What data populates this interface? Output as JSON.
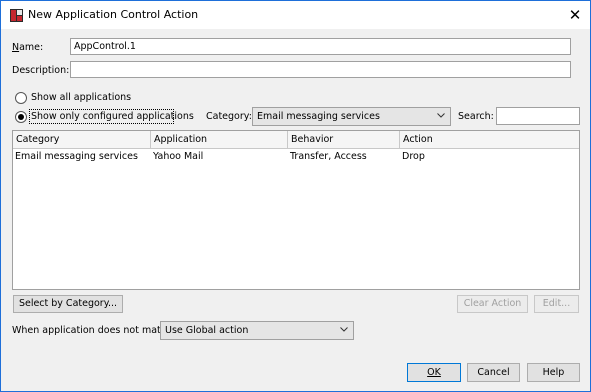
{
  "window": {
    "title": "New Application Control Action",
    "close_glyph": "✕",
    "icon": "app-icon"
  },
  "form": {
    "name_label": "Name:",
    "name_value": "AppControl.1",
    "description_label": "Description:",
    "description_value": ""
  },
  "filter": {
    "radio_all_label": "Show all applications",
    "radio_configured_label": "Show only configured applications",
    "selected": "configured",
    "category_label": "Category:",
    "category_value": "Email messaging services",
    "search_label": "Search:",
    "search_value": ""
  },
  "table": {
    "columns": [
      "Category",
      "Application",
      "Behavior",
      "Action"
    ],
    "rows": [
      [
        "Email messaging services",
        "Yahoo Mail",
        "Transfer, Access",
        "Drop"
      ]
    ]
  },
  "actions": {
    "select_by_category": "Select by Category...",
    "clear_action": "Clear Action",
    "edit": "Edit..."
  },
  "nomatch": {
    "label": "When application does not match:",
    "value": "Use Global action"
  },
  "footer": {
    "ok": "OK",
    "cancel": "Cancel",
    "help": "Help"
  },
  "colors": {
    "accent": "#0078d7",
    "window_border": "#1e6fd9",
    "dialog_bg": "#f0f0f0"
  }
}
